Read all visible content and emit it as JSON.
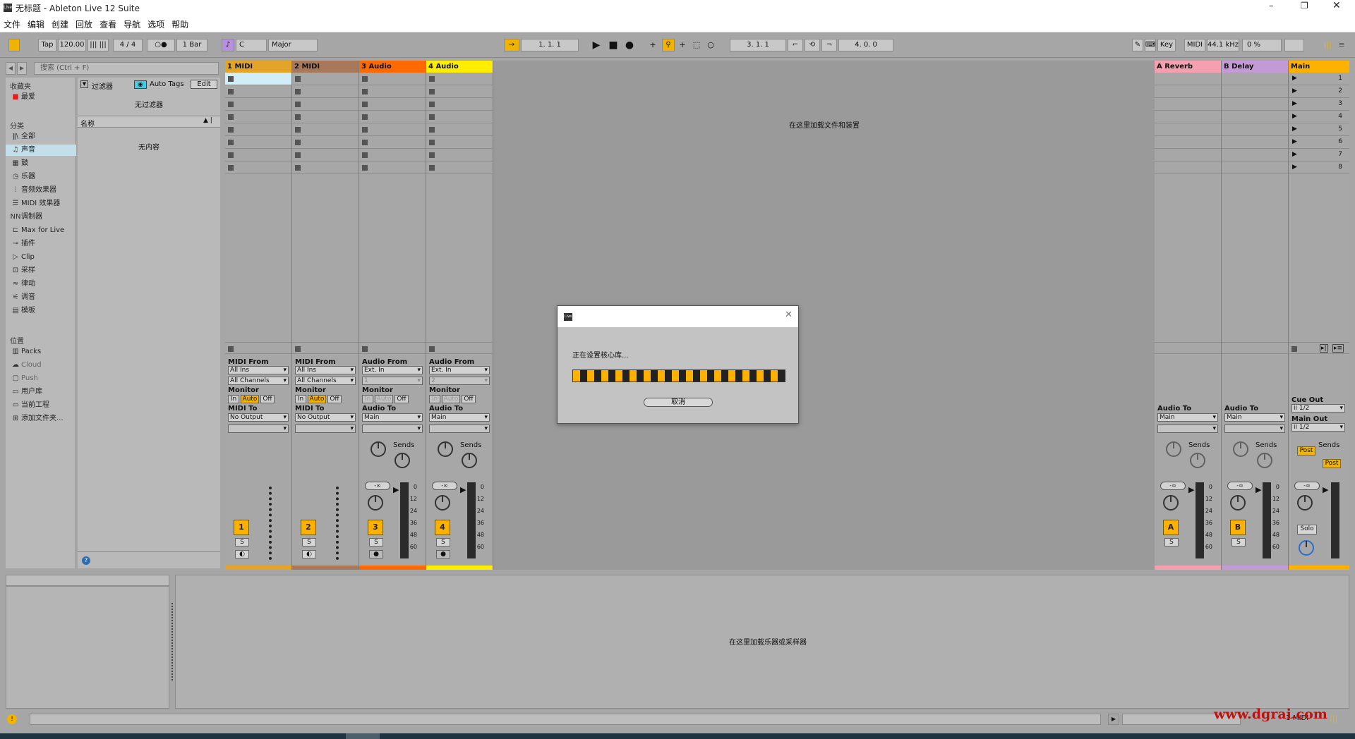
{
  "window": {
    "title": "无标题 - Ableton Live 12 Suite",
    "app_icon": "live-logo-icon"
  },
  "menu": [
    "文件",
    "编辑",
    "创建",
    "回放",
    "查看",
    "导航",
    "选项",
    "帮助"
  ],
  "toolbar": {
    "tap": "Tap",
    "tempo": "120.00",
    "signature": "4 / 4",
    "metronome": "○●",
    "quantize": "1 Bar",
    "key": "C",
    "scale": "Major",
    "arrangement_pos": "1.  1.  1",
    "loop_start": "3.  1.  1",
    "loop_length": "4.  0.  0",
    "key_label": "Key",
    "midi_label": "MIDI",
    "sample_rate": "44.1 kHz",
    "cpu": "0 %"
  },
  "browser": {
    "search_placeholder": "搜索 (Ctrl + F)",
    "favorites_header": "收藏夹",
    "favorite_item": "最爱",
    "categories_header": "分类",
    "categories": [
      "全部",
      "声音",
      "鼓",
      "乐器",
      "音频效果器",
      "MIDI 效果器",
      "调制器",
      "Max for Live",
      "插件",
      "Clip",
      "采样",
      "律动",
      "调音",
      "模板"
    ],
    "places_header": "位置",
    "places": [
      "Packs",
      "Cloud",
      "Push",
      "用户库",
      "当前工程",
      "添加文件夹..."
    ],
    "filter_label": "过滤器",
    "auto_tags": "Auto Tags",
    "edit": "Edit",
    "no_filter": "无过滤器",
    "name_col": "名称",
    "no_content": "无内容"
  },
  "tracks": [
    {
      "name": "1 MIDI",
      "color": "#e2a52a",
      "from_label": "MIDI From",
      "from": "All Ins",
      "channel": "All Channels",
      "to_label": "MIDI To",
      "to": "No Output",
      "number": "1",
      "type": "midi"
    },
    {
      "name": "2 MIDI",
      "color": "#a8785a",
      "from_label": "MIDI From",
      "from": "All Ins",
      "channel": "All Channels",
      "to_label": "MIDI To",
      "to": "No Output",
      "number": "2",
      "type": "midi"
    },
    {
      "name": "3 Audio",
      "color": "#ff6a00",
      "from_label": "Audio From",
      "from": "Ext. In",
      "channel": "1",
      "to_label": "Audio To",
      "to": "Main",
      "number": "3",
      "type": "audio"
    },
    {
      "name": "4 Audio",
      "color": "#ffee00",
      "from_label": "Audio From",
      "from": "Ext. In",
      "channel": "2",
      "to_label": "Audio To",
      "to": "Main",
      "number": "4",
      "type": "audio"
    }
  ],
  "returns": [
    {
      "name": "A Reverb",
      "color": "#f5a0b0",
      "to_label": "Audio To",
      "to": "Main",
      "number": "A"
    },
    {
      "name": "B Delay",
      "color": "#c39ad6",
      "to_label": "Audio To",
      "to": "Main",
      "number": "B"
    }
  ],
  "main": {
    "name": "Main",
    "color": "#ffb100",
    "scenes": [
      "1",
      "2",
      "3",
      "4",
      "5",
      "6",
      "7",
      "8"
    ],
    "cue_label": "Cue Out",
    "cue": "ii 1/2",
    "main_label": "Main Out",
    "main_out": "ii 1/2",
    "solo": "Solo",
    "post": "Post"
  },
  "session": {
    "drop_hint": "在这里加载文件和装置",
    "monitor": "Monitor",
    "in": "In",
    "auto": "Auto",
    "off": "Off",
    "sends": "Sends",
    "solo_btn": "S",
    "vol": "-∞",
    "scale": [
      "0",
      "12",
      "24",
      "36",
      "48",
      "60"
    ]
  },
  "dialog": {
    "message": "正在设置核心库...",
    "cancel": "取消",
    "progress_percent": 99
  },
  "detail": {
    "drop_hint": "在这里加载乐器或采样器"
  },
  "statusbar": {
    "track": "1-MIDI"
  },
  "watermark": "www.dgrai.com"
}
